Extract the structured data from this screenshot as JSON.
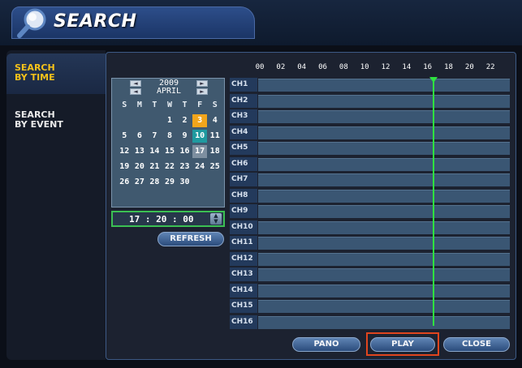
{
  "header": {
    "title": "SEARCH",
    "icon": "magnifier-icon"
  },
  "nav": {
    "items": [
      {
        "label_line1": "SEARCH",
        "label_line2": "BY TIME",
        "active": true
      },
      {
        "label_line1": "SEARCH",
        "label_line2": "BY EVENT",
        "active": false
      }
    ]
  },
  "calendar": {
    "year": "2009",
    "month": "APRIL",
    "weekdays": [
      "S",
      "M",
      "T",
      "W",
      "T",
      "F",
      "S"
    ],
    "days": [
      "",
      "",
      "",
      "1",
      "2",
      "3",
      "4",
      "5",
      "6",
      "7",
      "8",
      "9",
      "10",
      "11",
      "12",
      "13",
      "14",
      "15",
      "16",
      "17",
      "18",
      "19",
      "20",
      "21",
      "22",
      "23",
      "24",
      "25",
      "26",
      "27",
      "28",
      "29",
      "30",
      "",
      ""
    ],
    "selected_day": "3",
    "highlighted_day": "10",
    "recorded_day": "17"
  },
  "time": {
    "value": "17 : 20 : 00"
  },
  "buttons": {
    "refresh": "REFRESH",
    "pano": "PANO",
    "play": "PLAY",
    "close": "CLOSE"
  },
  "timeline": {
    "hours": [
      "00",
      "02",
      "04",
      "06",
      "08",
      "10",
      "12",
      "14",
      "16",
      "18",
      "20",
      "22"
    ],
    "channels": [
      "CH1",
      "CH2",
      "CH3",
      "CH4",
      "CH5",
      "CH6",
      "CH7",
      "CH8",
      "CH9",
      "CH10",
      "CH11",
      "CH12",
      "CH13",
      "CH14",
      "CH15",
      "CH16"
    ],
    "cursor_hour": 16.7
  },
  "colors": {
    "accent": "#f6c21a",
    "cursor": "#2ee23f",
    "play_outline": "#e0451e"
  }
}
